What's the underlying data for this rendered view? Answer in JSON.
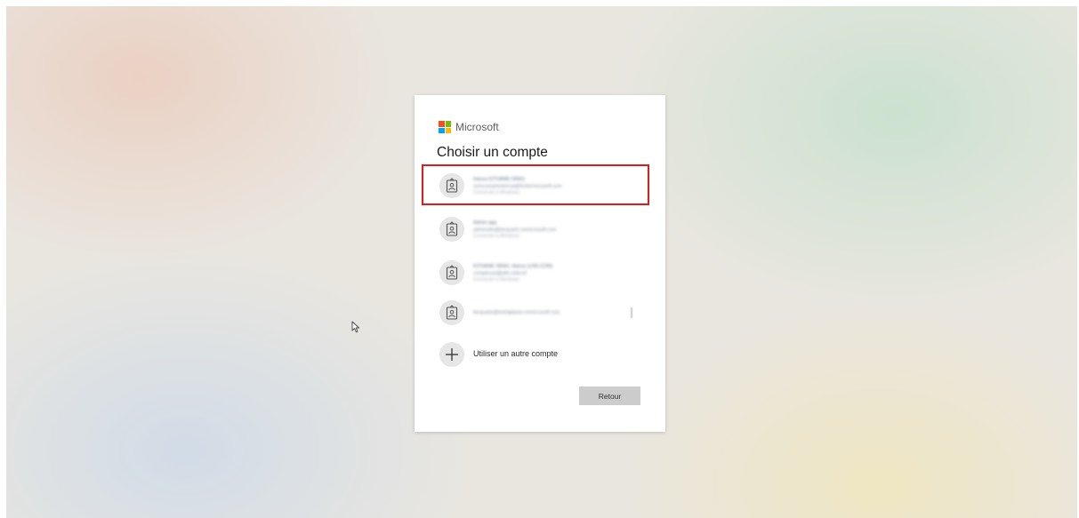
{
  "brand": {
    "name": "Microsoft",
    "logo_colors": [
      "#f25022",
      "#7fba00",
      "#00a4ef",
      "#ffb900"
    ]
  },
  "dialog": {
    "title": "Choisir un compte",
    "accounts": [
      {
        "icon": "badge-person-icon",
        "name": "Hanus KITHANE SRAS",
        "email": "nomcompteinternal@fichiernecaseft.com",
        "status": "Connecté à Windows"
      },
      {
        "icon": "badge-person-icon",
        "name": "Admin app",
        "email": "adminsite@bioquartz.onmicrosoft.com",
        "status": "Connecté à Windows"
      },
      {
        "icon": "badge-person-icon",
        "name": "KITHANE SRAS, Hanus (LNS-CON)",
        "email": "comptesurl@alto-ebte.bf",
        "status": "Connecté à Windows"
      },
      {
        "icon": "badge-person-icon",
        "email": "benjuarty@intelqplasts.onmicrosoft.com"
      }
    ],
    "add_account_label": "Utiliser un autre compte",
    "back_label": "Retour"
  },
  "colors": {
    "highlight": "#e11a1a",
    "button_bg": "#cccccc"
  }
}
